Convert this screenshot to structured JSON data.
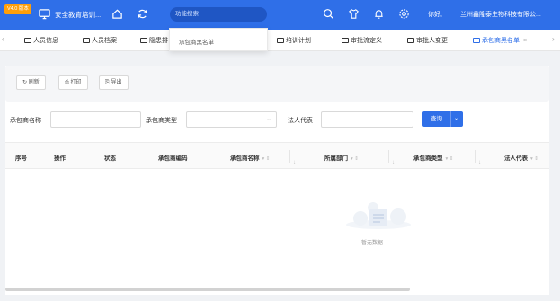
{
  "header": {
    "version_badge": "V4.0 版本",
    "title": "安全教育培训...",
    "search_placeholder": "功能搜索",
    "greeting": "你好,",
    "company": "兰州鑫隆泰生物科技有限公...",
    "colors": {
      "brand": "#2f6fe8",
      "badge": "#ff9f0a"
    },
    "icons": [
      "monitor-icon",
      "home-icon",
      "refresh-icon",
      "search-icon",
      "shirt-icon",
      "bell-icon",
      "gear-icon"
    ]
  },
  "search_dropdown": {
    "option": "承包商黑名单"
  },
  "tabs": [
    {
      "label": "人员信息"
    },
    {
      "label": "人员档案"
    },
    {
      "label": "隐患排"
    },
    {
      "label": "培训计划"
    },
    {
      "label": "审批流定义"
    },
    {
      "label": "审批人变更"
    },
    {
      "label": "承包商黑名单",
      "active": true
    }
  ],
  "toolbar": {
    "refresh_label": "刷新",
    "print_label": "打印",
    "export_label": "导出"
  },
  "filters": {
    "name_label": "承包商名称",
    "type_label": "承包商类型",
    "legal_label": "法人代表",
    "query_label": "查询"
  },
  "table": {
    "columns": [
      "序号",
      "操作",
      "状态",
      "承包商编码",
      "承包商名称",
      "所属部门",
      "承包商类型",
      "法人代表"
    ],
    "empty_text": "暂无数据"
  }
}
